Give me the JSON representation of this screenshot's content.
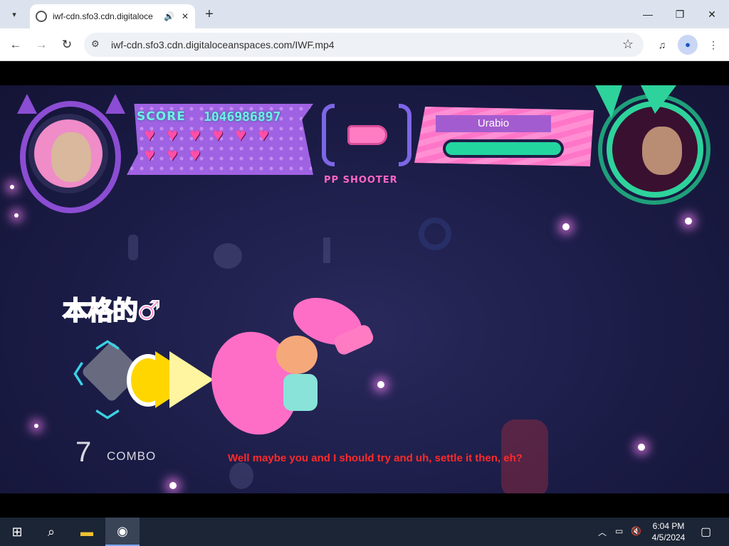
{
  "browser": {
    "tab_title": "iwf-cdn.sfo3.cdn.digitaloce",
    "url": "iwf-cdn.sfo3.cdn.digitaloceanspaces.com/IWF.mp4",
    "icons": {
      "tab_search": "chevron-down-icon",
      "audio": "speaker-icon",
      "close_tab": "close-icon",
      "new_tab": "plus-icon",
      "minimize": "minimize-icon",
      "maximize": "restore-icon",
      "close_window": "close-icon",
      "back": "arrow-left-icon",
      "forward": "arrow-right-icon",
      "reload": "reload-icon",
      "site_info": "tune-icon",
      "bookmark": "star-icon",
      "media": "media-control-icon",
      "profile": "profile-icon",
      "menu": "kebab-menu-icon"
    }
  },
  "game": {
    "score_label": "SCORE",
    "score_value": "1046986897",
    "lives": 9,
    "weapon_label": "PP SHOOTER",
    "opponent_name": "Urabio",
    "opponent_hp": 1.0,
    "jp_banner": "本格的♂",
    "combo_count": "7",
    "combo_label": "COMBO",
    "subtitle": "Well maybe you and I should try and uh, settle it then, eh?",
    "colors": {
      "score": "#6ff0e6",
      "hearts": "#ff4fa8",
      "hp": "#23d6a0",
      "subtitle": "#ff2a2a"
    }
  },
  "taskbar": {
    "time": "6:04 PM",
    "date": "4/5/2024",
    "icons": [
      "windows-start-icon",
      "search-icon",
      "file-explorer-icon",
      "chrome-icon"
    ],
    "tray_icons": [
      "chevron-up-icon",
      "network-icon",
      "volume-muted-icon",
      "notification-icon"
    ]
  }
}
